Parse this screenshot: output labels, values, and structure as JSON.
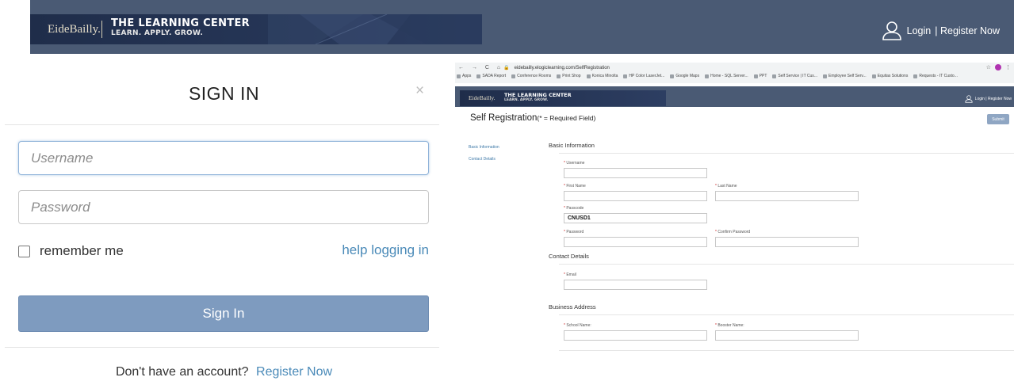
{
  "header": {
    "logo": "EideBailly.",
    "brand_title": "THE LEARNING CENTER",
    "brand_tagline": "LEARN. APPLY. GROW.",
    "login_link": "Login",
    "register_link": "| Register Now"
  },
  "signin_modal": {
    "title": "SIGN IN",
    "close": "×",
    "username_placeholder": "Username",
    "password_placeholder": "Password",
    "remember_me": "remember me",
    "help_link": "help logging in",
    "signin_button": "Sign In",
    "no_account_text": "Don't have an account?",
    "register_link": "Register Now"
  },
  "browser": {
    "nav_glyphs": "← → C ⌂",
    "url": "eidebailly.elogiclearning.com/SelfRegistration",
    "star": "☆",
    "menu": "⋮",
    "bookmarks": [
      "Apps",
      "SADA Report",
      "Conference Rooms",
      "Print Shop",
      "Konica Minolta",
      "HP Color LaserJet...",
      "Google Maps",
      "Home - SQL Server...",
      "PPT",
      "Self Service | IT Cus...",
      "Employee Self Serv...",
      "Equitas Solutions",
      "Requests - IT Custo..."
    ]
  },
  "registration_page": {
    "header": {
      "logo": "EideBailly.",
      "brand_title": "THE LEARNING CENTER",
      "brand_tagline": "LEARN. APPLY. GROW.",
      "user_links": "Login | Register Now"
    },
    "title": "Self Registration",
    "required_note": "(* = Required Field)",
    "submit_button": "Submit",
    "sidebar": [
      "Basic Information",
      "Contact Details"
    ],
    "sections": {
      "basic": "Basic Information",
      "contact": "Contact Details",
      "business": "Business Address"
    },
    "required_mark": "*",
    "fields": {
      "username": {
        "label": "Username",
        "value": ""
      },
      "first_name": {
        "label": "First Name",
        "value": ""
      },
      "last_name": {
        "label": "Last Name",
        "value": ""
      },
      "passcode": {
        "label": "Passcode",
        "value": "CNUSD1"
      },
      "password": {
        "label": "Password",
        "value": ""
      },
      "confirm_password": {
        "label": "Confirm Password",
        "value": ""
      },
      "email": {
        "label": "Email",
        "value": ""
      },
      "school_name": {
        "label": "School Name:",
        "value": ""
      },
      "booster_name": {
        "label": "Booster Name:",
        "value": ""
      }
    }
  },
  "colors": {
    "header_bg": "#4a5a74",
    "banner_bg": "#263657",
    "link": "#4a8ab8",
    "signin_button": "#7e9bbf",
    "required_star": "#cc2222"
  }
}
